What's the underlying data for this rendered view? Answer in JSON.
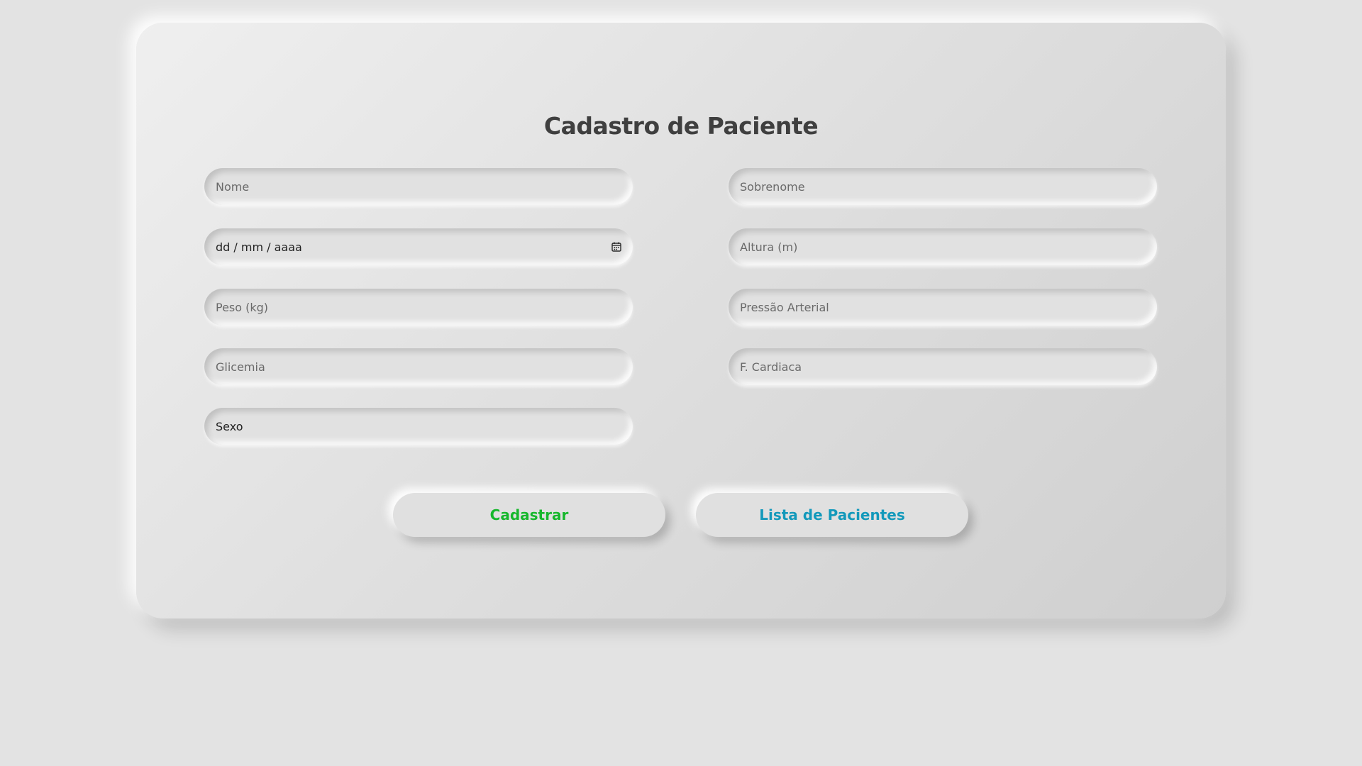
{
  "page": {
    "title": "Cadastro de Paciente"
  },
  "form": {
    "nome_placeholder": "Nome",
    "sobrenome_placeholder": "Sobrenome",
    "data_nascimento_value": "dd / mm / aaaa",
    "altura_placeholder": "Altura (m)",
    "peso_placeholder": "Peso (kg)",
    "pressao_placeholder": "Pressão Arterial",
    "glicemia_placeholder": "Glicemia",
    "frequencia_placeholder": "F. Cardiaca",
    "sexo_value": "Sexo",
    "calendar_icon": "calendar-icon"
  },
  "actions": {
    "cadastrar_label": "Cadastrar",
    "lista_label": "Lista de Pacientes"
  },
  "colors": {
    "background": "#e3e3e3",
    "title": "#3f3f3f",
    "cadastrar": "#16b72c",
    "lista": "#1399bb"
  }
}
